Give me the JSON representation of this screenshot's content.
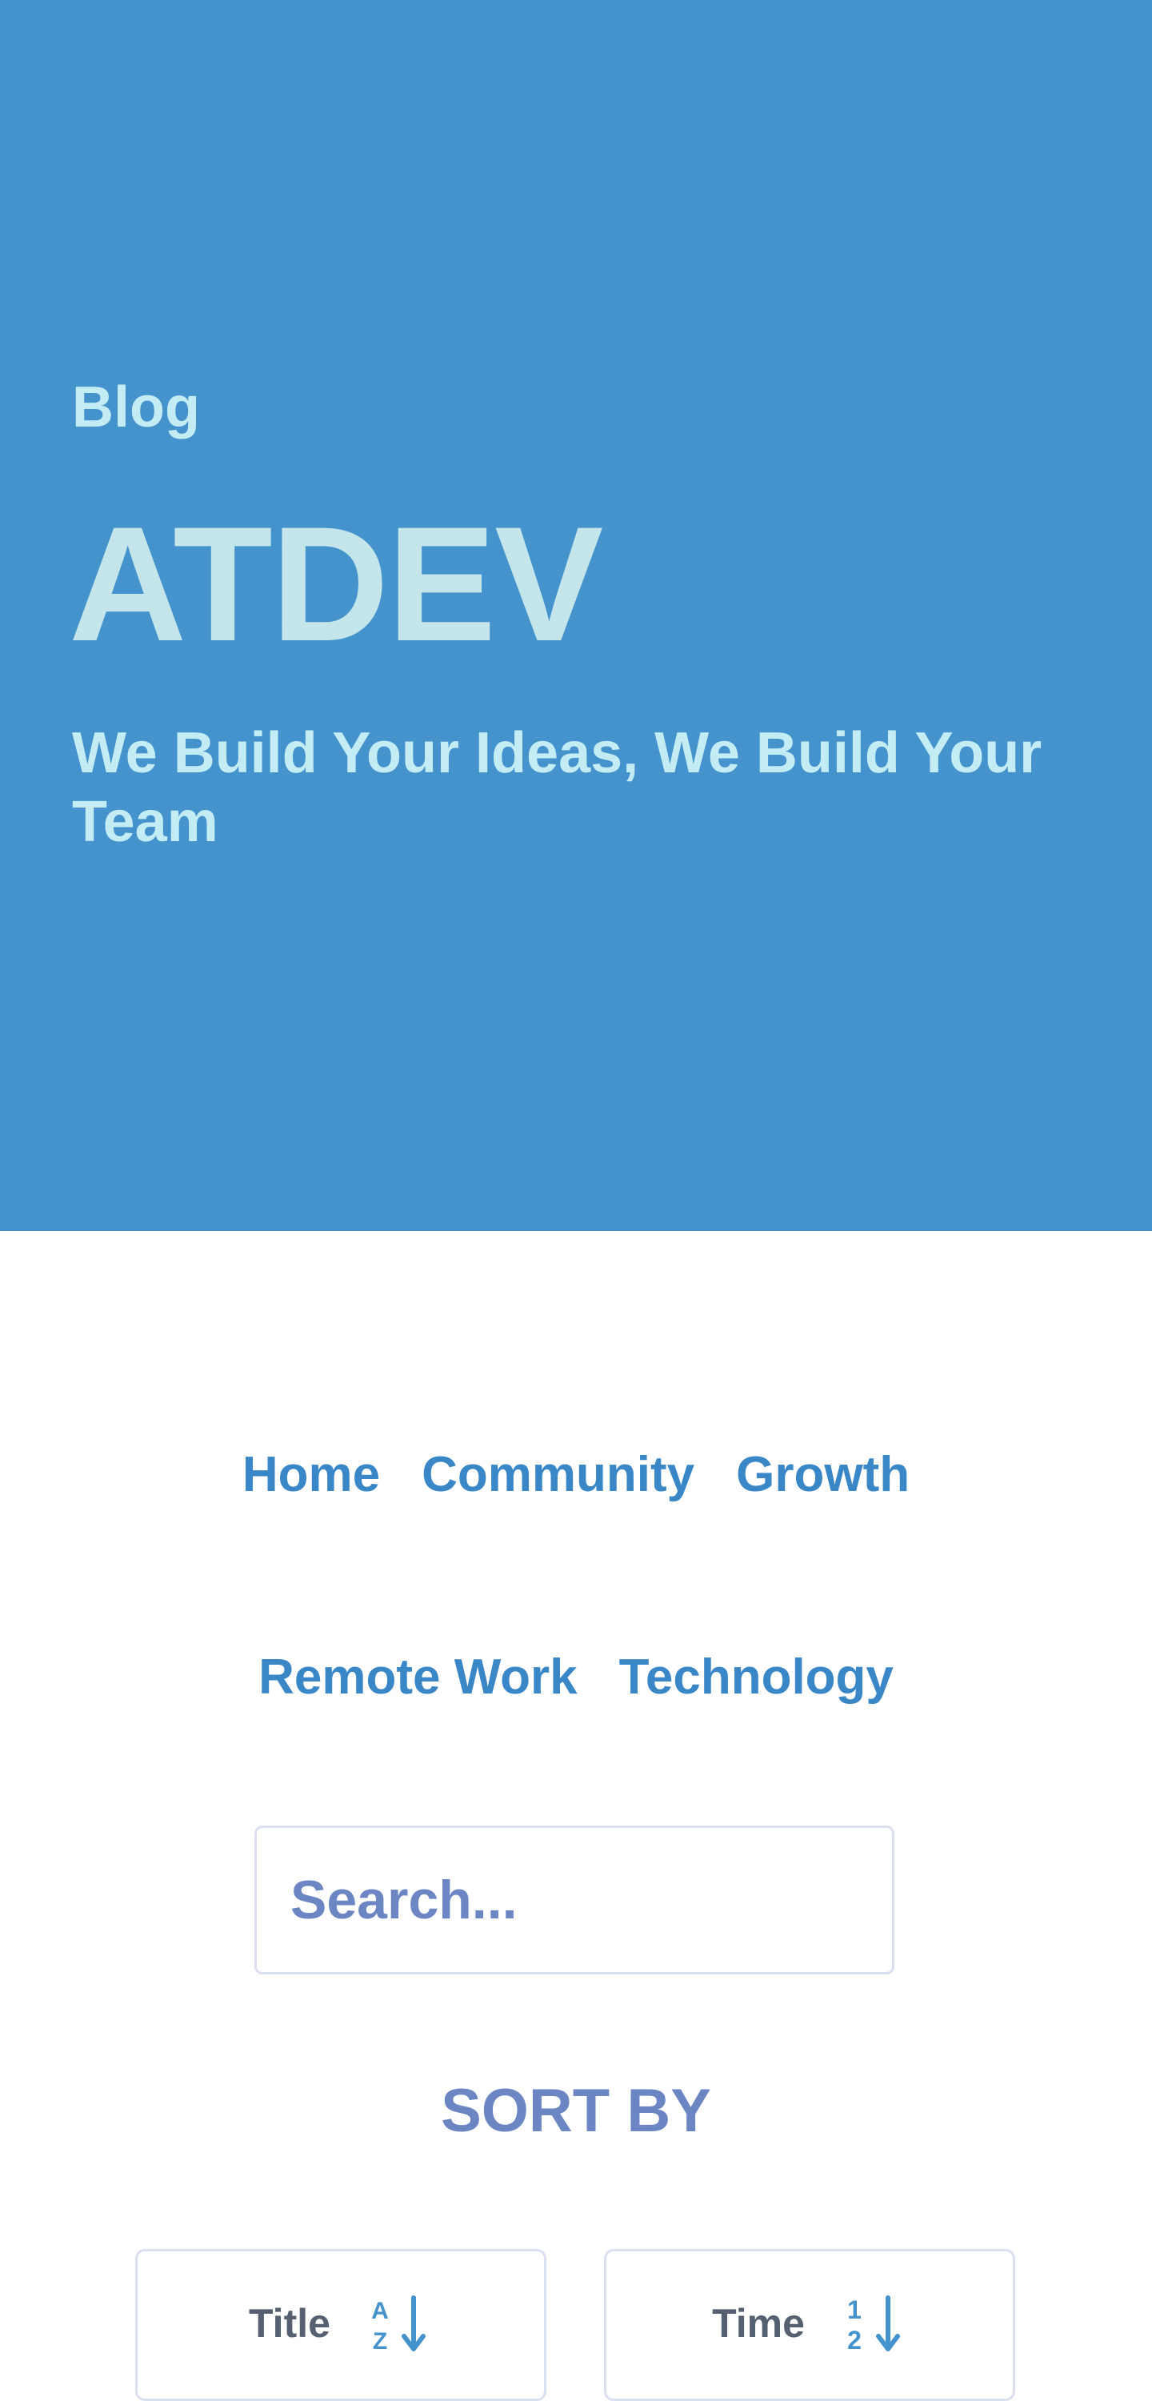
{
  "hero": {
    "label": "Blog",
    "title": "ATDEV",
    "tagline": "We Build Your Ideas, We Build Your Team"
  },
  "nav": {
    "row1": [
      "Home",
      "Community",
      "Growth"
    ],
    "row2": [
      "Remote Work",
      "Technology"
    ]
  },
  "search": {
    "placeholder": "Search..."
  },
  "sort": {
    "heading": "SORT BY",
    "title_label": "Title",
    "time_label": "Time",
    "title_icon": "sort-alpha-asc-icon",
    "time_icon": "sort-numeric-asc-icon"
  },
  "colors": {
    "hero_bg": "#4493cd",
    "hero_text": "#c4ecf4",
    "link": "#3a87c8",
    "muted_blue": "#6c86c4",
    "border": "#dcdff0"
  }
}
